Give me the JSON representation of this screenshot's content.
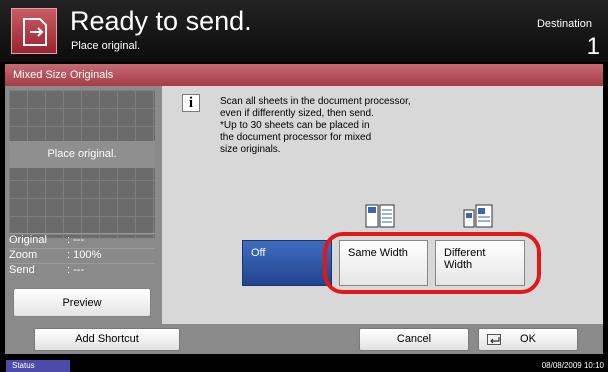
{
  "header": {
    "title": "Ready to send.",
    "subtitle": "Place original.",
    "destination_label": "Destination",
    "destination_count": "1",
    "icon": "send-arrow-icon"
  },
  "dialog": {
    "title": "Mixed Size Originals",
    "message_lines": [
      "Scan all sheets in the document processor,",
      "even if differently sized, then send.",
      "*Up to 30 sheets can be placed in",
      "the document processor for mixed",
      "size originals."
    ]
  },
  "preview": {
    "placeholder": "Place original.",
    "rows": [
      {
        "label": "Original",
        "value": ": ---"
      },
      {
        "label": "Zoom",
        "value": ": 100%"
      },
      {
        "label": "Send",
        "value": ": ---"
      }
    ],
    "preview_button": "Preview"
  },
  "options": {
    "off": "Off",
    "same_width": "Same Width",
    "different_width_line1": "Different",
    "different_width_line2": "Width",
    "selected": "Off"
  },
  "footer": {
    "add_shortcut": "Add Shortcut",
    "cancel": "Cancel",
    "ok": "OK"
  },
  "status": {
    "tab": "Status",
    "datetime": "08/08/2009   10:10"
  },
  "colors": {
    "accent_red": "#a43d47",
    "selected_blue": "#22448f",
    "highlight": "#e01818"
  }
}
